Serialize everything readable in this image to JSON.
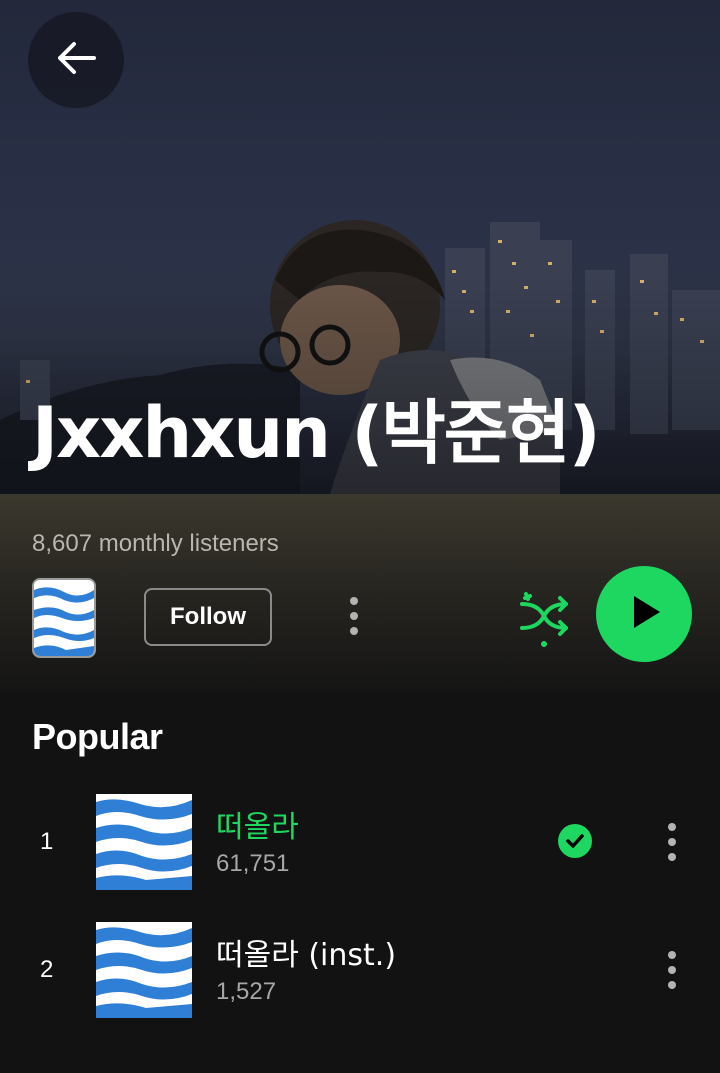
{
  "artist": {
    "name": "Jxxhxun (박준현)",
    "monthly_listeners": "8,607 monthly listeners"
  },
  "actions": {
    "follow_label": "Follow"
  },
  "section": {
    "popular_title": "Popular"
  },
  "tracks": [
    {
      "number": "1",
      "title": "떠올라",
      "plays": "61,751",
      "playing": true,
      "saved": true
    },
    {
      "number": "2",
      "title": "떠올라 (inst.)",
      "plays": "1,527",
      "playing": false,
      "saved": false
    }
  ],
  "icons": {
    "back": "back-arrow-icon",
    "more": "more-vertical-icon",
    "shuffle": "shuffle-icon",
    "play": "play-icon",
    "saved": "check-circle-icon"
  },
  "colors": {
    "accent": "#1ed760",
    "background": "#121212",
    "secondary_text": "#a7a7a7"
  }
}
